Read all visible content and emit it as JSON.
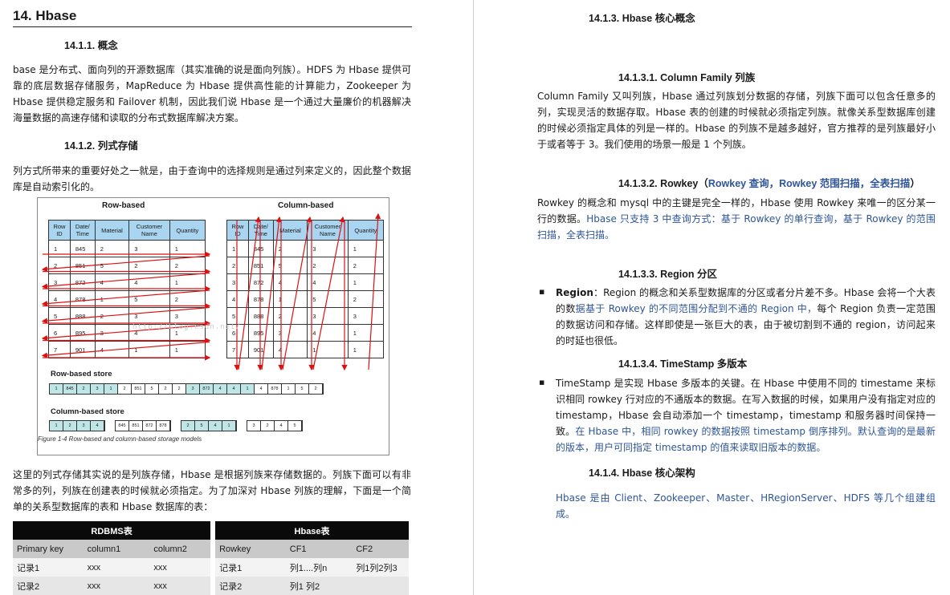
{
  "left": {
    "heading": "14.  Hbase",
    "s1_title": "14.1.1.    概念",
    "s1_body": "base 是分布式、面向列的开源数据库（其实准确的说是面向列族）。HDFS 为 Hbase 提供可靠的底层数据存储服务，MapReduce 为 Hbase 提供高性能的计算能力，Zookeeper 为 Hbase 提供稳定服务和 Failover 机制，因此我们说 Hbase 是一个通过大量廉价的机器解决海量数据的高速存储和读取的分布式数据库解决方案。",
    "s2_title": "14.1.2.    列式存储",
    "s2_body": "列方式所带来的重要好处之一就是，由于查询中的选择规则是通过列来定义的，因此整个数据库是自动索引化的。",
    "s2_body2": "这里的列式存储其实说的是列族存储，Hbase 是根据列族来存储数据的。列族下面可以有非常多的列，列族在创建表的时候就必须指定。为了加深对 Hbase 列族的理解，下面是一个简单的关系型数据库的表和 Hbase 数据库的表："
  },
  "figure": {
    "row_title": "Row-based",
    "col_title": "Column-based",
    "headers": [
      "Row\nID",
      "Date/\nTime",
      "Material",
      "Customer\nName",
      "Quantity"
    ],
    "rows": [
      [
        "1",
        "845",
        "2",
        "3",
        "1"
      ],
      [
        "2",
        "851",
        "5",
        "2",
        "2"
      ],
      [
        "3",
        "872",
        "4",
        "4",
        "1"
      ],
      [
        "4",
        "878",
        "1",
        "5",
        "2"
      ],
      [
        "5",
        "888",
        "2",
        "3",
        "3"
      ],
      [
        "6",
        "895",
        "3",
        "4",
        "1"
      ],
      [
        "7",
        "901",
        "4",
        "1",
        "1"
      ]
    ],
    "row_store_label": "Row-based store",
    "row_store": [
      [
        "1",
        "845",
        "2",
        "3",
        "1"
      ],
      [
        "2",
        "851",
        "5",
        "2",
        "2"
      ],
      [
        "3",
        "872",
        "4",
        "4",
        "1"
      ],
      [
        "4",
        "878",
        "1",
        "5",
        "2"
      ]
    ],
    "col_store_label": "Column-based store",
    "col_store": [
      [
        "1",
        "2",
        "3",
        "4"
      ],
      [
        "845",
        "851",
        "872",
        "878"
      ],
      [
        "2",
        "5",
        "4",
        "1"
      ],
      [
        "3",
        "2",
        "4",
        "5"
      ]
    ],
    "watermark": "http://blog.csdn.net/",
    "caption": "Figure 1-4   Row-based and column-based storage models"
  },
  "compare": {
    "rdbms_title": "RDBMS表",
    "hbase_title": "Hbase表",
    "rdbms_cols": [
      "Primary key",
      "column1",
      "column2"
    ],
    "hbase_cols": [
      "Rowkey",
      "CF1",
      "CF2"
    ],
    "rows": [
      {
        "rdbms": [
          "记录1",
          "xxx",
          "xxx"
        ],
        "hbase": [
          "记录1",
          "列1....列n",
          "列1列2列3"
        ]
      },
      {
        "rdbms": [
          "记录2",
          "xxx",
          "xxx"
        ],
        "hbase": [
          "记录2",
          "列1 列2",
          ""
        ]
      }
    ]
  },
  "right": {
    "s3_title": "14.1.3.    Hbase 核心概念",
    "cf_title": "14.1.3.1.  Column Family 列族",
    "cf_body": "Column Family 又叫列族，Hbase 通过列族划分数据的存储，列族下面可以包含任意多的列，实现灵活的数据存取。Hbase 表的创建的时候就必须指定列族。就像关系型数据库创建的时候必须指定具体的列是一样的。Hbase 的列族不是越多越好，官方推荐的是列族最好小于或者等于 3。我们使用的场景一般是 1 个列族。",
    "rk_title": "14.1.3.2.  Rowkey（",
    "rk_title_blue": "Rowkey 查询，Rowkey 范围扫描，全表扫描",
    "rk_title_end": "）",
    "rk_body_1": "Rowkey 的概念和 mysql 中的主键是完全一样的，Hbase 使用 Rowkey 来唯一的区分某一行的数据。",
    "rk_body_2": "Hbase 只支持 3 中查询方式：基于 Rowkey 的单行查询，基于 Rowkey 的范围扫描，全表扫描。",
    "rg_title": "14.1.3.3.  Region 分区",
    "rg_bold": "Region",
    "rg_body_1": "：Region 的概念和关系型数据库的分区或者分片差不多。Hbase 会将一个大表的数",
    "rg_body_blue": "据基于 Rowkey 的不同范围分配到不通的 Region 中，",
    "rg_body_2": "每个 Region 负责一定范围的数据访问和存储。这样即使是一张巨大的表，由于被切割到不通的 region，访问起来的时延也很低。",
    "ts_title": "14.1.3.4.  TimeStamp 多版本",
    "ts_body_1": "TimeStamp 是实现 Hbase 多版本的关键。在 Hbase 中使用不同的 timestame 来标识相同 rowkey 行对应的不通版本的数据。在写入数据的时候，如果用户没有指定对应的 timestamp，Hbase 会自动添加一个 timestamp，timestamp 和服务器时间保持一致。",
    "ts_body_blue": "在 Hbase 中，相同 rowkey 的数据按照 timestamp 倒序排列。默认查询的是最新的版本，用户可同指定 timestamp 的值来读取旧版本的数据。",
    "arch_title": "14.1.4.    Hbase 核心架构",
    "arch_body": "Hbase 是由 Client、Zookeeper、Master、HRegionServer、HDFS 等几个组建组成。"
  }
}
